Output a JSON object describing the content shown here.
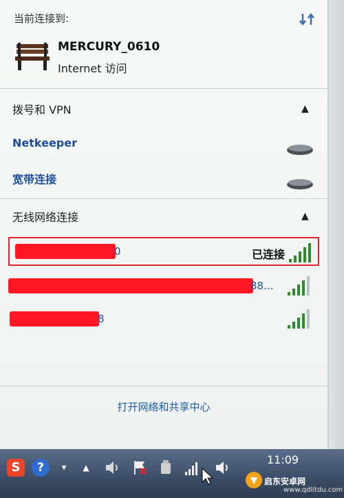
{
  "header": {
    "label": "当前连接到:",
    "refresh_icon": "network-refresh-icon"
  },
  "current_connection": {
    "name": "MERCURY_0610",
    "status": "Internet 访问"
  },
  "dialup_section": {
    "title": "拨号和 VPN",
    "items": [
      {
        "label": "Netkeeper"
      },
      {
        "label": "宽带连接"
      }
    ]
  },
  "wireless_section": {
    "title": "无线网络连接",
    "networks": [
      {
        "ssid_tail": "0",
        "status": "已连接",
        "signal": 5,
        "selected": true
      },
      {
        "ssid_tail": "88...",
        "status": "",
        "signal": 4,
        "selected": false
      },
      {
        "ssid_tail": "8",
        "status": "",
        "signal": 4,
        "selected": false
      }
    ]
  },
  "footer": {
    "link": "打开网络和共享中心"
  },
  "taskbar": {
    "clock": "11:09",
    "icons": [
      "sogou-ime-icon",
      "help-icon",
      "chevron-icon",
      "show-hidden-icon",
      "volume-mute-icon",
      "action-center-flag-icon",
      "usb-device-icon",
      "network-signal-icon",
      "volume-icon"
    ]
  },
  "watermark": {
    "text": "启东安卓网",
    "url": "www.qdlitdu.com"
  },
  "colors": {
    "accent_link": "#1f4f9a",
    "selection": "#e0252a",
    "redaction": "#ff1726"
  }
}
